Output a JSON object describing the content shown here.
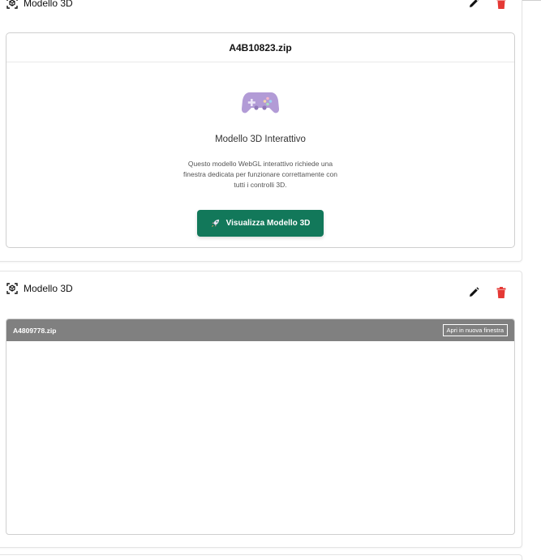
{
  "cards": [
    {
      "title": "Modello 3D",
      "viewer": {
        "filename": "A4B10823.zip",
        "heading": "Modello 3D Interattivo",
        "description": "Questo modello WebGL interattivo richiede una finestra dedicata per funzionare correttamente con tutti i controlli 3D.",
        "button_label": "Visualizza Modello 3D",
        "button_icon": "rocket-icon",
        "placeholder_icon": "gamepad-icon",
        "button_color": "#12785a"
      }
    },
    {
      "title": "Modello 3D",
      "viewer": {
        "filename": "A4809778.zip",
        "popout_label": "Apri in nuova finestra",
        "bar_color": "#808080"
      }
    }
  ],
  "colors": {
    "edit_icon": "#111111",
    "delete_icon": "#e53935"
  }
}
